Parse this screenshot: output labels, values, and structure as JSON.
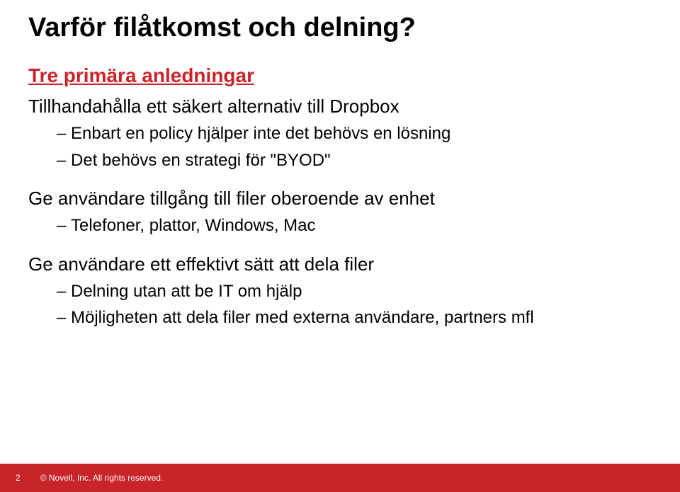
{
  "title": "Varför filåtkomst och delning?",
  "subtitle": "Tre primära anledningar",
  "sections": [
    {
      "heading": "Tillhandahålla ett säkert alternativ till Dropbox",
      "items": [
        "Enbart en policy hjälper inte det behövs en lösning",
        "Det behövs en strategi för \"BYOD\""
      ]
    },
    {
      "heading": "Ge användare tillgång till filer oberoende av enhet",
      "items": [
        "Telefoner, plattor, Windows, Mac"
      ]
    },
    {
      "heading": "Ge användare ett effektivt sätt att dela filer",
      "items": [
        "Delning utan att be IT om hjälp",
        "Möjligheten att dela filer med externa användare, partners mfl"
      ]
    }
  ],
  "footer": {
    "page": "2",
    "copyright": "© Novell, Inc. All rights reserved."
  }
}
